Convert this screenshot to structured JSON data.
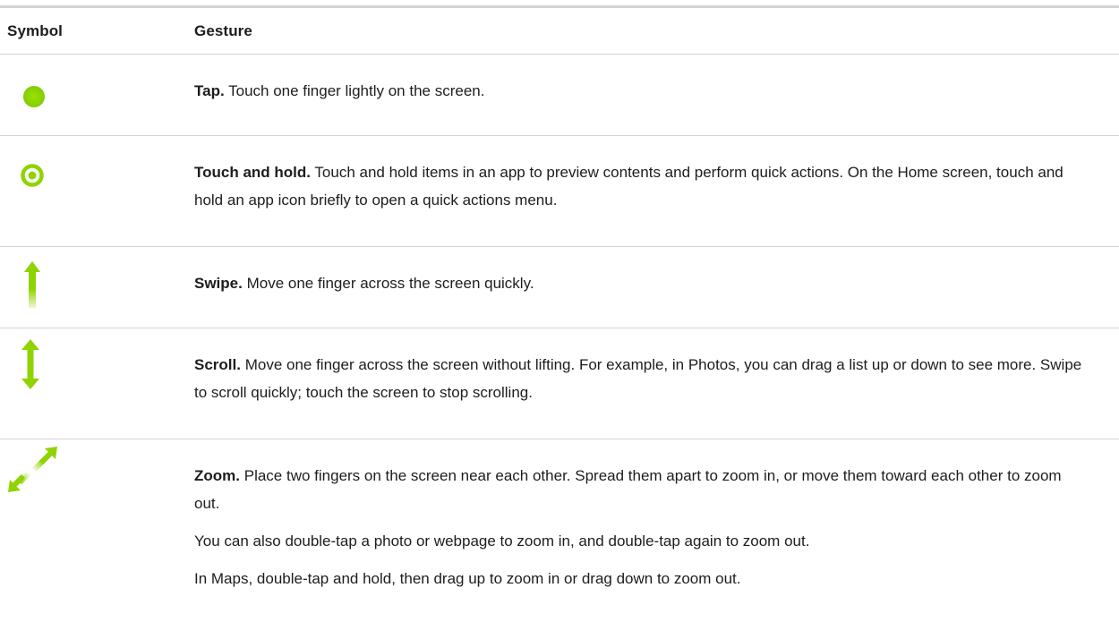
{
  "table": {
    "headers": {
      "symbol": "Symbol",
      "gesture": "Gesture"
    },
    "rows": [
      {
        "icon": "tap-dot-icon",
        "lead": "Tap.",
        "paragraphs": [
          "Touch one finger lightly on the screen."
        ]
      },
      {
        "icon": "touch-and-hold-target-icon",
        "lead": "Touch and hold.",
        "paragraphs": [
          "Touch and hold items in an app to preview contents and perform quick actions. On the Home screen, touch and hold an app icon briefly to open a quick actions menu."
        ]
      },
      {
        "icon": "swipe-up-arrow-icon",
        "lead": "Swipe.",
        "paragraphs": [
          "Move one finger across the screen quickly."
        ]
      },
      {
        "icon": "scroll-up-down-arrow-icon",
        "lead": "Scroll.",
        "paragraphs": [
          "Move one finger across the screen without lifting. For example, in Photos, you can drag a list up or down to see more. Swipe to scroll quickly; touch the screen to stop scrolling."
        ]
      },
      {
        "icon": "zoom-diagonal-arrows-icon",
        "lead": "Zoom.",
        "paragraphs": [
          "Place two fingers on the screen near each other. Spread them apart to zoom in, or move them toward each other to zoom out.",
          "You can also double-tap a photo or webpage to zoom in, and double-tap again to zoom out.",
          "In Maps, double-tap and hold, then drag up to zoom in or drag down to zoom out."
        ]
      }
    ]
  },
  "colors": {
    "accent": "#8fd400",
    "text": "#1d1d1f",
    "divider": "#d2d2d7"
  }
}
